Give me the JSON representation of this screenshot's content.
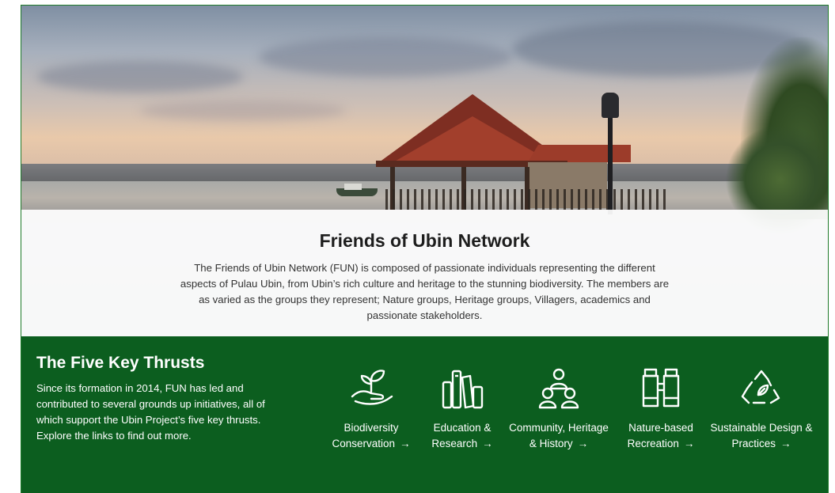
{
  "intro": {
    "title": "Friends of Ubin Network",
    "body": "The Friends of Ubin Network (FUN) is composed of passionate individuals representing the different aspects of Pulau Ubin, from Ubin’s rich culture and heritage to the stunning biodiversity. The members are as varied as the groups they represent; Nature groups, Heritage groups, Villagers, academics and passionate stakeholders."
  },
  "thrusts_section": {
    "title": "The Five Key Thrusts",
    "lead": "Since its formation in 2014, FUN has led and contributed to several grounds up initiatives, all of which support the Ubin Project’s five key thrusts. Explore the links to find out more.",
    "arrow": "→",
    "items": [
      {
        "label": "Biodiversity Conservation",
        "icon": "hand-sprout-icon"
      },
      {
        "label": "Education & Research",
        "icon": "books-icon"
      },
      {
        "label": "Community, Heritage & History",
        "icon": "people-group-icon"
      },
      {
        "label": "Nature-based Recreation",
        "icon": "binoculars-icon"
      },
      {
        "label": "Sustainable Design & Practices",
        "icon": "recycle-leaf-icon"
      }
    ]
  },
  "colors": {
    "accent_green": "#0c5e1f",
    "frame_green": "#1f7a2a"
  }
}
